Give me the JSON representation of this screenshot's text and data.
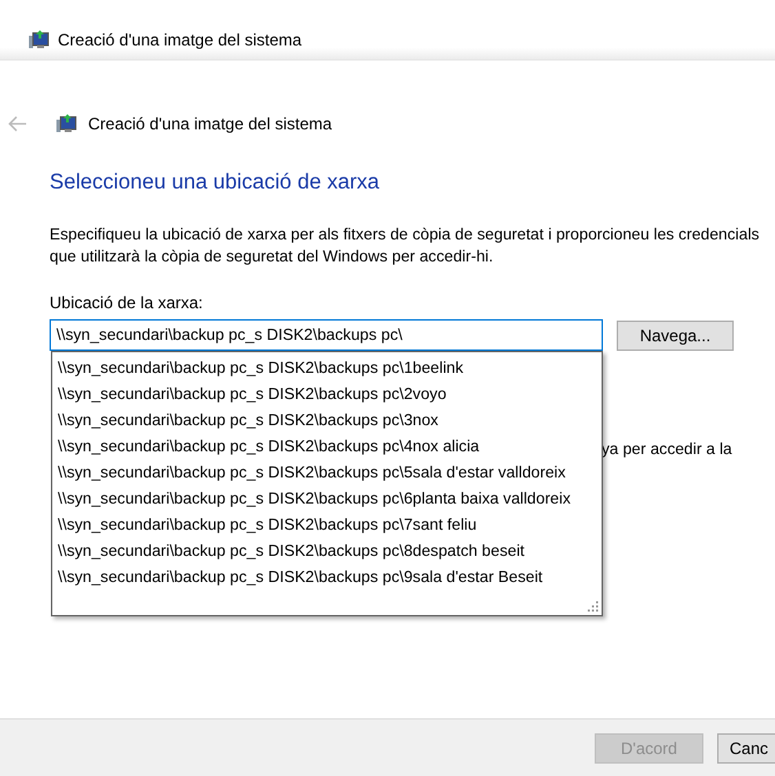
{
  "window": {
    "title": "Creació d'una imatge del sistema"
  },
  "header": {
    "title": "Creació d'una imatge del sistema"
  },
  "heading": "Seleccioneu una ubicació de xarxa",
  "description": "Especifiqueu la ubicació de xarxa per als fitxers de còpia de seguretat i proporcioneu les credencials que utilitzarà la còpia de seguretat del Windows per accedir-hi.",
  "location": {
    "label": "Ubicació de la xarxa:",
    "value": "\\\\syn_secundari\\backup pc_s DISK2\\backups pc\\",
    "browse": "Navega..."
  },
  "suggestions": [
    "\\\\syn_secundari\\backup pc_s DISK2\\backups pc\\1beelink",
    "\\\\syn_secundari\\backup pc_s DISK2\\backups pc\\2voyo",
    "\\\\syn_secundari\\backup pc_s DISK2\\backups pc\\3nox",
    "\\\\syn_secundari\\backup pc_s DISK2\\backups pc\\4nox alicia",
    "\\\\syn_secundari\\backup pc_s DISK2\\backups pc\\5sala d'estar valldoreix",
    "\\\\syn_secundari\\backup pc_s DISK2\\backups pc\\6planta baixa valldoreix",
    "\\\\syn_secundari\\backup pc_s DISK2\\backups pc\\7sant feliu",
    "\\\\syn_secundari\\backup pc_s DISK2\\backups pc\\8despatch beseit",
    "\\\\syn_secundari\\backup pc_s DISK2\\backups pc\\9sala d'estar Beseit"
  ],
  "hidden_text": "ya per accedir a la",
  "buttons": [
    {
      "label": "D'acord",
      "disabled": true
    },
    {
      "label": "Canc",
      "disabled": false
    }
  ]
}
